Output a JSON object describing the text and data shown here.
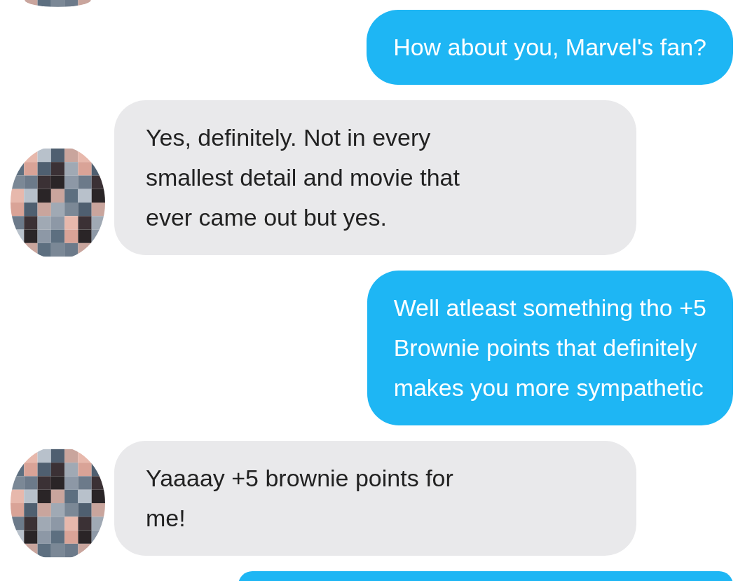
{
  "messages": [
    {
      "outgoing": true,
      "lines": [
        "How about you, Marvel's fan?"
      ]
    },
    {
      "outgoing": false,
      "lines": [
        "Yes, definitely. Not in every",
        "smallest detail and movie that",
        "ever came out but yes."
      ]
    },
    {
      "outgoing": true,
      "lines": [
        "Well atleast something tho +5",
        "Brownie points that definitely",
        "makes you more sympathetic"
      ]
    },
    {
      "outgoing": false,
      "lines": [
        "Yaaaay +5 brownie points for",
        "me!"
      ]
    },
    {
      "outgoing": true
    }
  ]
}
